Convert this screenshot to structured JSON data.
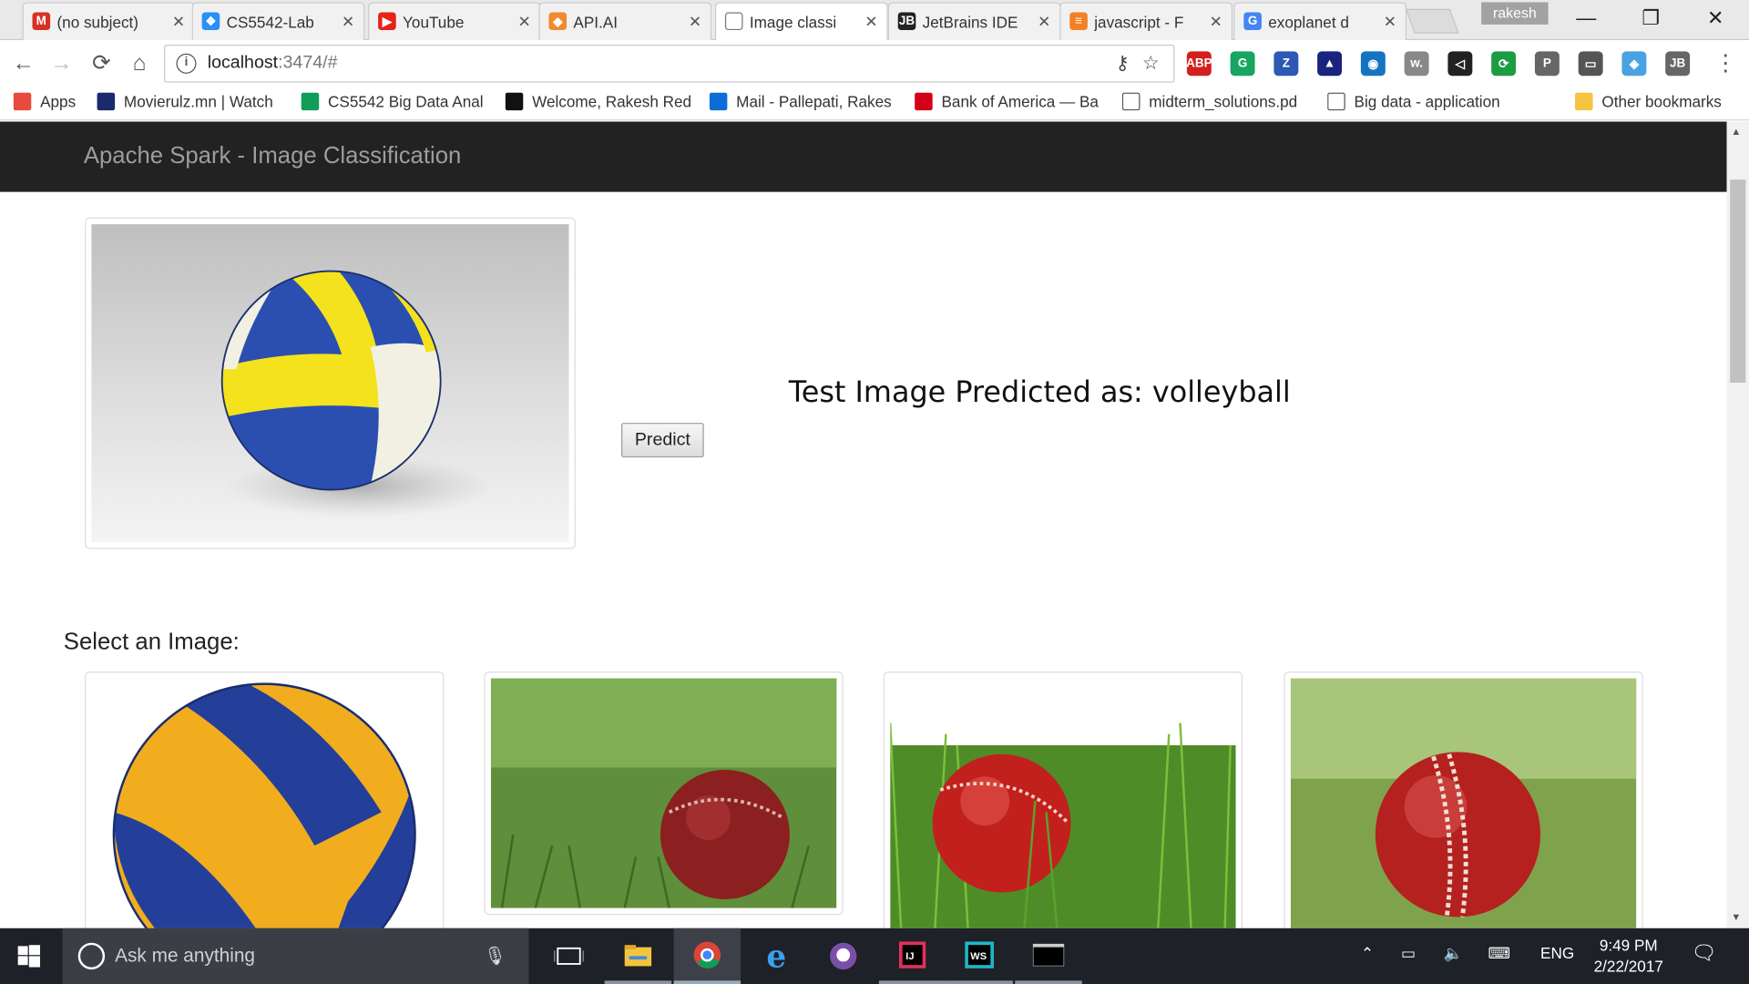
{
  "browser": {
    "tabs": [
      {
        "title": "(no subject)",
        "favicon": "gmail-icon",
        "color": "#d93025",
        "glyph": "M"
      },
      {
        "title": "CS5542-Lab",
        "favicon": "dropbox-icon",
        "color": "#2a8ff7",
        "glyph": "❖"
      },
      {
        "title": "YouTube",
        "favicon": "youtube-icon",
        "color": "#e62117",
        "glyph": "▶"
      },
      {
        "title": "API.AI",
        "favicon": "apiai-icon",
        "color": "#f28b30",
        "glyph": "◆"
      },
      {
        "title": "Image classi",
        "favicon": "page-icon",
        "color": "#ffffff",
        "glyph": ""
      },
      {
        "title": "JetBrains IDE",
        "favicon": "jetbrains-icon",
        "color": "#222222",
        "glyph": "JB"
      },
      {
        "title": "javascript - F",
        "favicon": "stackoverflow-icon",
        "color": "#f48024",
        "glyph": "≡"
      },
      {
        "title": "exoplanet d",
        "favicon": "google-icon",
        "color": "#4285f4",
        "glyph": "G"
      }
    ],
    "active_tab": 4,
    "profile_name": "rakesh",
    "url_host": "localhost",
    "url_path": ":3474/#",
    "extensions": [
      {
        "name": "adblock-plus-icon",
        "color": "#d41f1f",
        "glyph": "ABP"
      },
      {
        "name": "grammarly-new-icon",
        "color": "#17a661",
        "glyph": "G"
      },
      {
        "name": "zotero-icon",
        "color": "#2d59b5",
        "glyph": "Z"
      },
      {
        "name": "zoom-icon",
        "color": "#1a237e",
        "glyph": "▲"
      },
      {
        "name": "loop-icon",
        "color": "#1574c1",
        "glyph": "◉"
      },
      {
        "name": "wordtune-icon",
        "color": "#888888",
        "glyph": "w."
      },
      {
        "name": "visual-studio-icon",
        "color": "#222222",
        "glyph": "◁"
      },
      {
        "name": "sync-icon",
        "color": "#1c9c44",
        "glyph": "⟳"
      },
      {
        "name": "pocket-icon",
        "color": "#666666",
        "glyph": "P"
      },
      {
        "name": "cast-icon",
        "color": "#555555",
        "glyph": "▭"
      },
      {
        "name": "edge-ext-icon",
        "color": "#4aa3e0",
        "glyph": "◈"
      },
      {
        "name": "jetbrains-ext-icon",
        "color": "#666666",
        "glyph": "JB"
      }
    ],
    "bookmarks": [
      {
        "label": "Apps",
        "icon": "apps-icon"
      },
      {
        "label": "Movierulz.mn | Watch",
        "icon": "movierulz-icon"
      },
      {
        "label": "CS5542 Big Data Anal",
        "icon": "sheets-icon"
      },
      {
        "label": "Welcome, Rakesh Red",
        "icon": "blackboard-icon"
      },
      {
        "label": "Mail - Pallepati, Rakes",
        "icon": "mail-icon"
      },
      {
        "label": "Bank of America — Ba",
        "icon": "bofa-icon"
      },
      {
        "label": "midterm_solutions.pd",
        "icon": "file-icon"
      },
      {
        "label": "Big data - application",
        "icon": "file-icon"
      }
    ],
    "other_bookmarks": "Other bookmarks"
  },
  "page": {
    "brand": "Apache Spark - Image Classification",
    "predict_label": "Predict",
    "result_text": "Test Image Predicted as: volleyball",
    "select_label": "Select an Image:",
    "test_image": "volleyball-render",
    "gallery": [
      "mikasa-volleyball",
      "cricket-ball-grass-1",
      "cricket-ball-grass-2",
      "cricket-ball-grass-3"
    ]
  },
  "taskbar": {
    "search_placeholder": "Ask me anything",
    "apps": [
      "task-view-icon",
      "file-explorer-icon",
      "chrome-icon",
      "edge-icon",
      "github-icon",
      "intellij-icon",
      "webstorm-icon",
      "cmd-icon"
    ],
    "language": "ENG",
    "time": "9:49 PM",
    "date": "2/22/2017"
  }
}
